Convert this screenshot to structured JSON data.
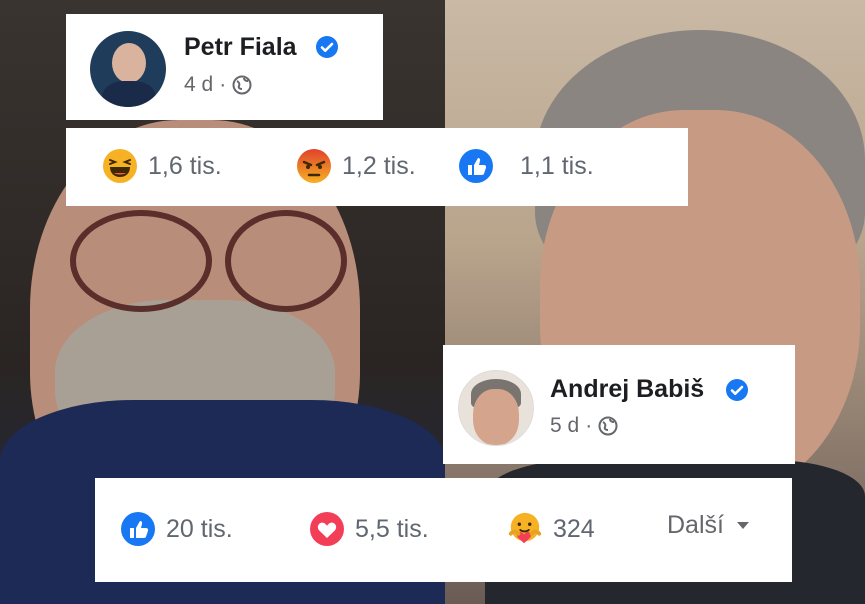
{
  "posts": [
    {
      "author": "Petr Fiala",
      "age": "4 d",
      "separator": "·",
      "reactions": [
        {
          "icon": "haha-emoji-icon",
          "count": "1,6 tis."
        },
        {
          "icon": "angry-emoji-icon",
          "count": "1,2 tis."
        },
        {
          "icon": "like-thumb-icon",
          "count": "1,1 tis."
        }
      ]
    },
    {
      "author": "Andrej Babiš",
      "age": "5 d",
      "separator": "·",
      "reactions": [
        {
          "icon": "like-thumb-icon",
          "count": "20 tis."
        },
        {
          "icon": "love-heart-icon",
          "count": "5,5 tis."
        },
        {
          "icon": "care-hug-emoji-icon",
          "count": "324"
        }
      ],
      "more_label": "Další"
    }
  ],
  "colors": {
    "facebook_blue": "#1877f2",
    "love_red": "#f33e58",
    "angry_orange": "#e9710f",
    "haha_yellow": "#f7b125"
  }
}
